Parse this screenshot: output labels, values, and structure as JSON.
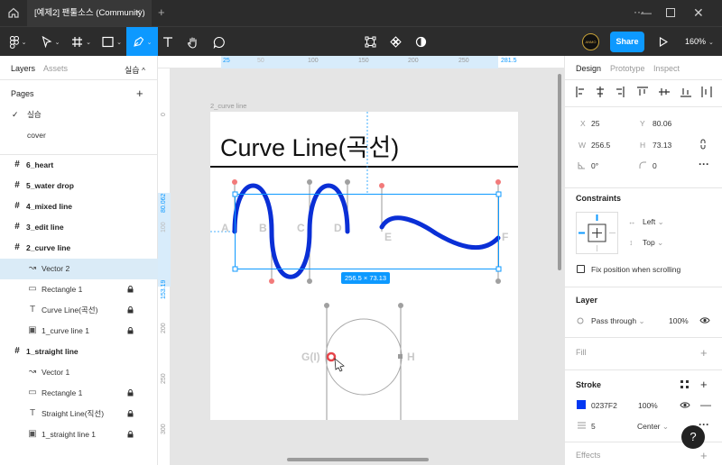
{
  "window": {
    "tab_title": "[예제2] 팬툴소스 (Community)",
    "tab_close": "×",
    "new_tab": "+",
    "more": "···",
    "minimize": "—",
    "close": "✕"
  },
  "toolbar": {
    "share_label": "Share",
    "zoom": "160%",
    "avatar_text": "ANMO"
  },
  "left_panel": {
    "tabs": {
      "layers": "Layers",
      "assets": "Assets",
      "page_menu": "실습"
    },
    "pages_title": "Pages",
    "add_page": "+",
    "pages": [
      {
        "label": "실습",
        "checked": "✓"
      },
      {
        "label": "cover",
        "checked": ""
      }
    ],
    "layers": [
      {
        "label": "6_heart",
        "type": "frame"
      },
      {
        "label": "5_water drop",
        "type": "frame"
      },
      {
        "label": "4_mixed line",
        "type": "frame"
      },
      {
        "label": "3_edit line",
        "type": "frame"
      },
      {
        "label": "2_curve line",
        "type": "frame"
      },
      {
        "label": "Vector 2",
        "type": "vector"
      },
      {
        "label": "Rectangle 1",
        "type": "rectangle"
      },
      {
        "label": "Curve Line(곡선)",
        "type": "text"
      },
      {
        "label": "1_curve line 1",
        "type": "image"
      },
      {
        "label": "1_straight line",
        "type": "frame"
      },
      {
        "label": "Vector 1",
        "type": "vector"
      },
      {
        "label": "Rectangle 1",
        "type": "rectangle"
      },
      {
        "label": "Straight Line(직선)",
        "type": "text"
      },
      {
        "label": "1_straight line 1",
        "type": "image"
      }
    ]
  },
  "canvas": {
    "ruler_top": [
      "25",
      "50",
      "100",
      "150",
      "200",
      "250",
      "281.5"
    ],
    "ruler_left": [
      "0",
      "80.062",
      "100",
      "153.19",
      "200",
      "250",
      "300"
    ],
    "frame_label": "2_curve line",
    "heading": "Curve Line(곡선)",
    "point_labels": [
      "A",
      "B",
      "C",
      "D",
      "E",
      "F",
      "G(I)",
      "H"
    ],
    "size_badge": "256.5 × 73.13",
    "stroke_color": "#0237F2",
    "selection_color": "#0d99ff"
  },
  "right_panel": {
    "tabs": {
      "design": "Design",
      "prototype": "Prototype",
      "inspect": "Inspect"
    },
    "x_label": "X",
    "x_value": "25",
    "y_label": "Y",
    "y_value": "80.06",
    "w_label": "W",
    "w_value": "256.5",
    "h_label": "H",
    "h_value": "73.13",
    "rotation": "0°",
    "radius": "0",
    "constraints_title": "Constraints",
    "constraint_h": "Left",
    "constraint_v": "Top",
    "fix_position": "Fix position when scrolling",
    "layer_title": "Layer",
    "blend_mode": "Pass through",
    "layer_opacity": "100%",
    "fill_title": "Fill",
    "stroke_title": "Stroke",
    "stroke_hex": "0237F2",
    "stroke_opacity": "100%",
    "stroke_weight": "5",
    "stroke_align": "Center",
    "effects_title": "Effects",
    "help": "?"
  }
}
